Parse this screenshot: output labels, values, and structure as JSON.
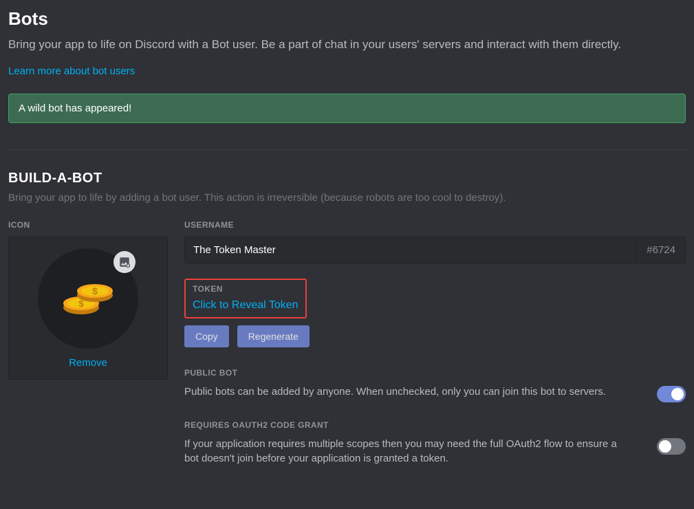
{
  "header": {
    "title": "Bots",
    "description": "Bring your app to life on Discord with a Bot user. Be a part of chat in your users' servers and interact with them directly.",
    "learn_more": "Learn more about bot users"
  },
  "notice": {
    "text": "A wild bot has appeared!"
  },
  "build": {
    "title": "BUILD-A-BOT",
    "subtitle": "Bring your app to life by adding a bot user. This action is irreversible (because robots are too cool to destroy)."
  },
  "icon": {
    "label": "ICON",
    "remove": "Remove"
  },
  "username": {
    "label": "USERNAME",
    "value": "The Token Master",
    "discriminator": "#6724"
  },
  "token": {
    "label": "TOKEN",
    "reveal": "Click to Reveal Token",
    "copy": "Copy",
    "regenerate": "Regenerate"
  },
  "public_bot": {
    "label": "PUBLIC BOT",
    "desc": "Public bots can be added by anyone. When unchecked, only you can join this bot to servers.",
    "enabled": true
  },
  "oauth_grant": {
    "label": "REQUIRES OAUTH2 CODE GRANT",
    "desc": "If your application requires multiple scopes then you may need the full OAuth2 flow to ensure a bot doesn't join before your application is granted a token.",
    "enabled": false
  }
}
